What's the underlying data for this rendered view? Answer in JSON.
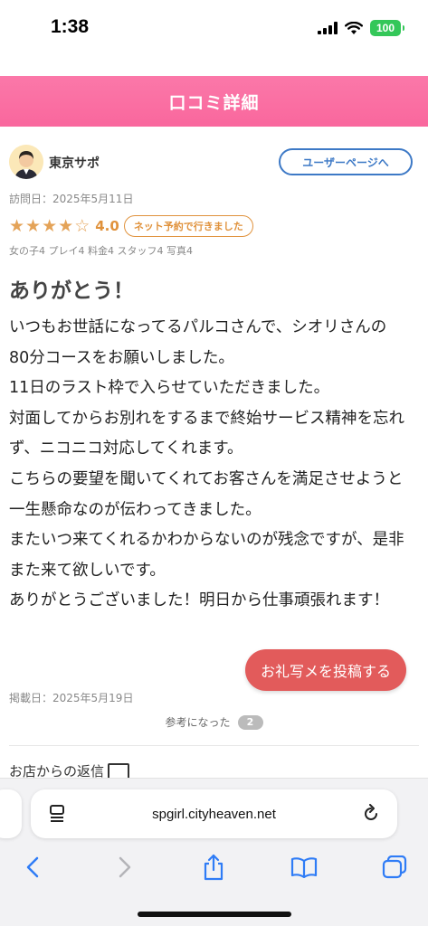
{
  "status_bar": {
    "time": "1:38",
    "battery": "100",
    "icons": [
      "signal-icon",
      "wifi-icon",
      "battery-icon"
    ]
  },
  "header": {
    "title": "口コミ詳細",
    "color": "#f9679d"
  },
  "author": {
    "name": "東京サポ",
    "user_page_label": "ユーザーページへ"
  },
  "review": {
    "visit_date": "訪問日：2025年5月11日",
    "rating": 4.0,
    "rating_text": "4.0",
    "stars_filled": 4,
    "stars_total": 5,
    "net_badge": "ネット予約で行きました",
    "sub_ratings": "女の子4 プレイ4 料金4 スタッフ4 写真4",
    "title": "ありがとう！",
    "body": "いつもお世話になってるパルコさんで、シオリさんの\n80分コースをお願いしました。\n11日のラスト枠で入らせていただきました。\n対面してからお別れをするまで終始サービス精神を忘れず、ニコニコ対応してくれます。\nこちらの要望を聞いてくれてお客さんを満足させようと一生懸命なのが伝わってきました。\nまたいつ来てくれるかわからないのが残念ですが、是非また来て欲しいです。\nありがとうございました！明日から仕事頑張れます！",
    "posted_date": "掲載日：2025年5月19日",
    "helpful_label": "参考になった",
    "helpful_count": "2"
  },
  "floating_button": {
    "label": "お礼写メを投稿する",
    "color": "#e25b5b"
  },
  "shop_reply": {
    "label": "お店からの返信"
  },
  "browser": {
    "url": "spgirl.cityheaven.net",
    "toolbar_icons": [
      "back-icon",
      "forward-icon",
      "share-icon",
      "bookmarks-icon",
      "tabs-icon"
    ],
    "accent": "#2f7cf6"
  }
}
